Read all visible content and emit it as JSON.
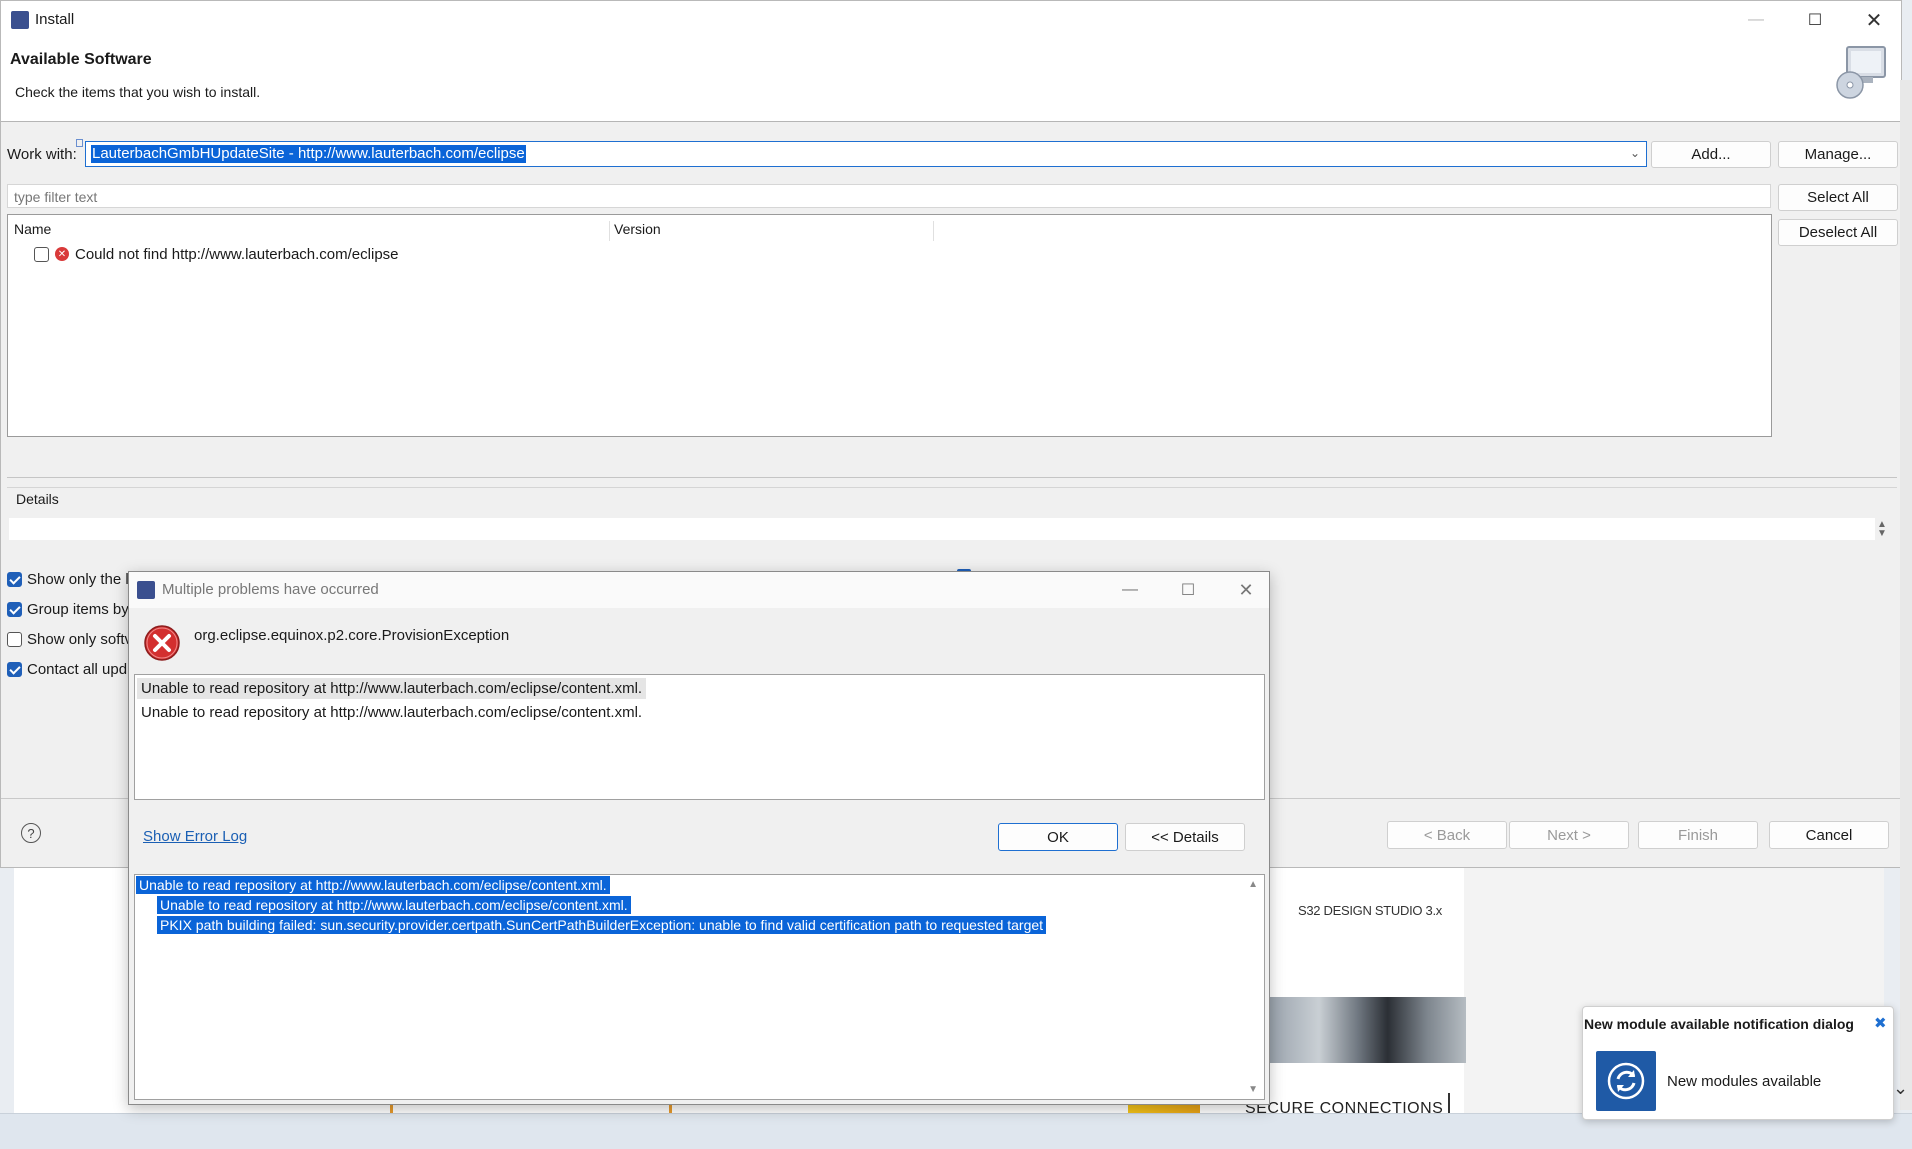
{
  "install": {
    "title": "Install",
    "heading": "Available Software",
    "subheading": "Check the items that you wish to install.",
    "work_with_label": "Work with:",
    "work_with_value": "LauterbachGmbHUpdateSite - http://www.lauterbach.com/eclipse",
    "add_label": "Add...",
    "manage_label": "Manage...",
    "filter_placeholder": "type filter text",
    "select_all_label": "Select All",
    "deselect_all_label": "Deselect All",
    "columns": [
      "Name",
      "Version"
    ],
    "rows": [
      {
        "name": "Could not find http://www.lauterbach.com/eclipse"
      }
    ],
    "details_label": "Details",
    "options": [
      {
        "label": "Show only the l",
        "checked": true
      },
      {
        "label": "Group items by",
        "checked": true
      },
      {
        "label": "Show only softv",
        "checked": false
      },
      {
        "label": "Contact all upd",
        "checked": true
      }
    ],
    "back_label": "< Back",
    "next_label": "Next >",
    "finish_label": "Finish",
    "cancel_label": "Cancel"
  },
  "error_dialog": {
    "title": "Multiple problems have occurred",
    "exception": "org.eclipse.equinox.p2.core.ProvisionException",
    "messages": [
      "Unable to read repository at http://www.lauterbach.com/eclipse/content.xml.",
      "Unable to read repository at http://www.lauterbach.com/eclipse/content.xml."
    ],
    "show_error_log": "Show Error Log",
    "ok_label": "OK",
    "details_label": "<< Details",
    "details_lines": [
      "Unable to read repository at http://www.lauterbach.com/eclipse/content.xml.",
      "Unable to read repository at http://www.lauterbach.com/eclipse/content.xml.",
      "PKIX path building failed: sun.security.provider.certpath.SunCertPathBuilderException: unable to find valid certification path to requested target"
    ]
  },
  "background": {
    "studio_text": "S32 DESIGN STUDIO 3.x",
    "secure_text": "SECURE CONNECTIONS"
  },
  "notification": {
    "title": "New module available notification dialog",
    "message": "New modules available"
  }
}
